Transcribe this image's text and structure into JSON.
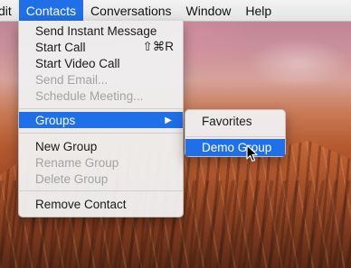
{
  "menubar": {
    "items": [
      "dit",
      "Contacts",
      "Conversations",
      "Window",
      "Help"
    ],
    "active_index": 1
  },
  "contacts_menu": {
    "send_im": "Send Instant Message",
    "start_call": "Start Call",
    "start_call_shortcut": "⇧⌘R",
    "start_video_call": "Start Video Call",
    "send_email": "Send Email...",
    "schedule_meeting": "Schedule Meeting...",
    "groups": "Groups",
    "groups_arrow": "▶",
    "new_group": "New Group",
    "rename_group": "Rename Group",
    "delete_group": "Delete Group",
    "remove_contact": "Remove Contact"
  },
  "groups_submenu": {
    "favorites": "Favorites",
    "demo_group": "Demo Group"
  },
  "colors": {
    "highlight": "#1f6fe8",
    "menu_bg": "#eeeeee",
    "disabled_text": "#a3a3a3"
  },
  "icons": {
    "cursor": "arrow-pointer-icon",
    "submenu_arrow": "triangle-right-icon"
  }
}
